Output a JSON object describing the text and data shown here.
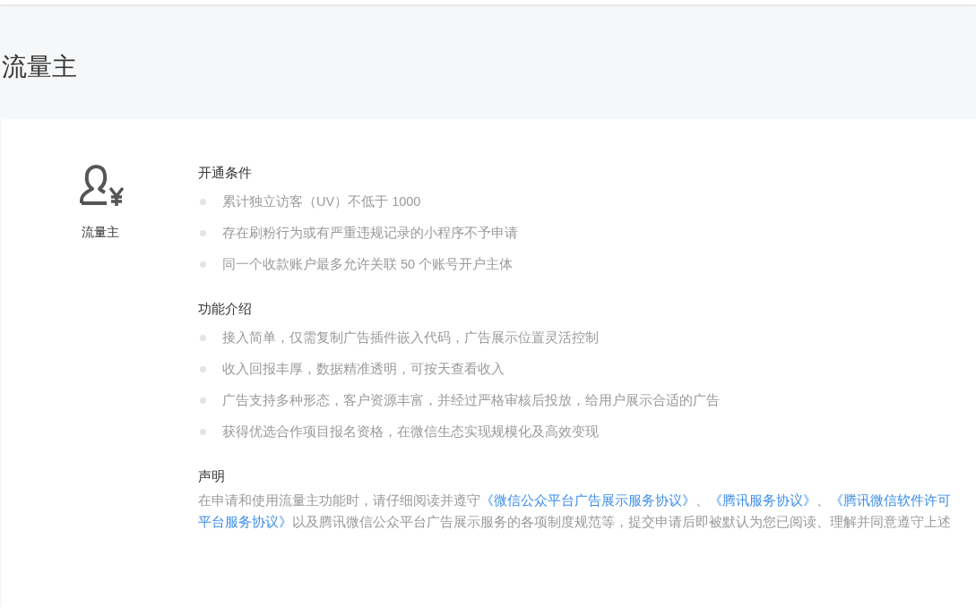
{
  "page_title": "流量主",
  "product": {
    "name": "流量主"
  },
  "sections": [
    {
      "heading": "开通条件",
      "items": [
        "累计独立访客（UV）不低于 1000",
        "存在刷粉行为或有严重违规记录的小程序不予申请",
        "同一个收款账户最多允许关联 50 个账号开户主体"
      ]
    },
    {
      "heading": "功能介绍",
      "items": [
        "接入简单，仅需复制广告插件嵌入代码，广告展示位置灵活控制",
        "收入回报丰厚，数据精准透明，可按天查看收入",
        "广告支持多种形态，客户资源丰富，并经过严格审核后投放，给用户展示合适的广告",
        "获得优选合作项目报名资格，在微信生态实现规模化及高效变现"
      ]
    }
  ],
  "statement": {
    "heading": "声明",
    "lines": [
      [
        {
          "kind": "text",
          "text": "在申请和使用流量主功能时，请仔细阅读并遵守"
        },
        {
          "kind": "link",
          "text": "《微信公众平台广告展示服务协议》"
        },
        {
          "kind": "text",
          "text": "、"
        },
        {
          "kind": "link",
          "text": "《腾讯服务协议》"
        },
        {
          "kind": "text",
          "text": "、"
        },
        {
          "kind": "link",
          "text": "《腾讯微信软件许可"
        }
      ],
      [
        {
          "kind": "link",
          "text": "平台服务协议》"
        },
        {
          "kind": "text",
          "text": "以及腾讯微信公众平台广告展示服务的各项制度规范等，提交申请后即被默认为您已阅读、理解并同意遵守上述"
        }
      ]
    ]
  }
}
